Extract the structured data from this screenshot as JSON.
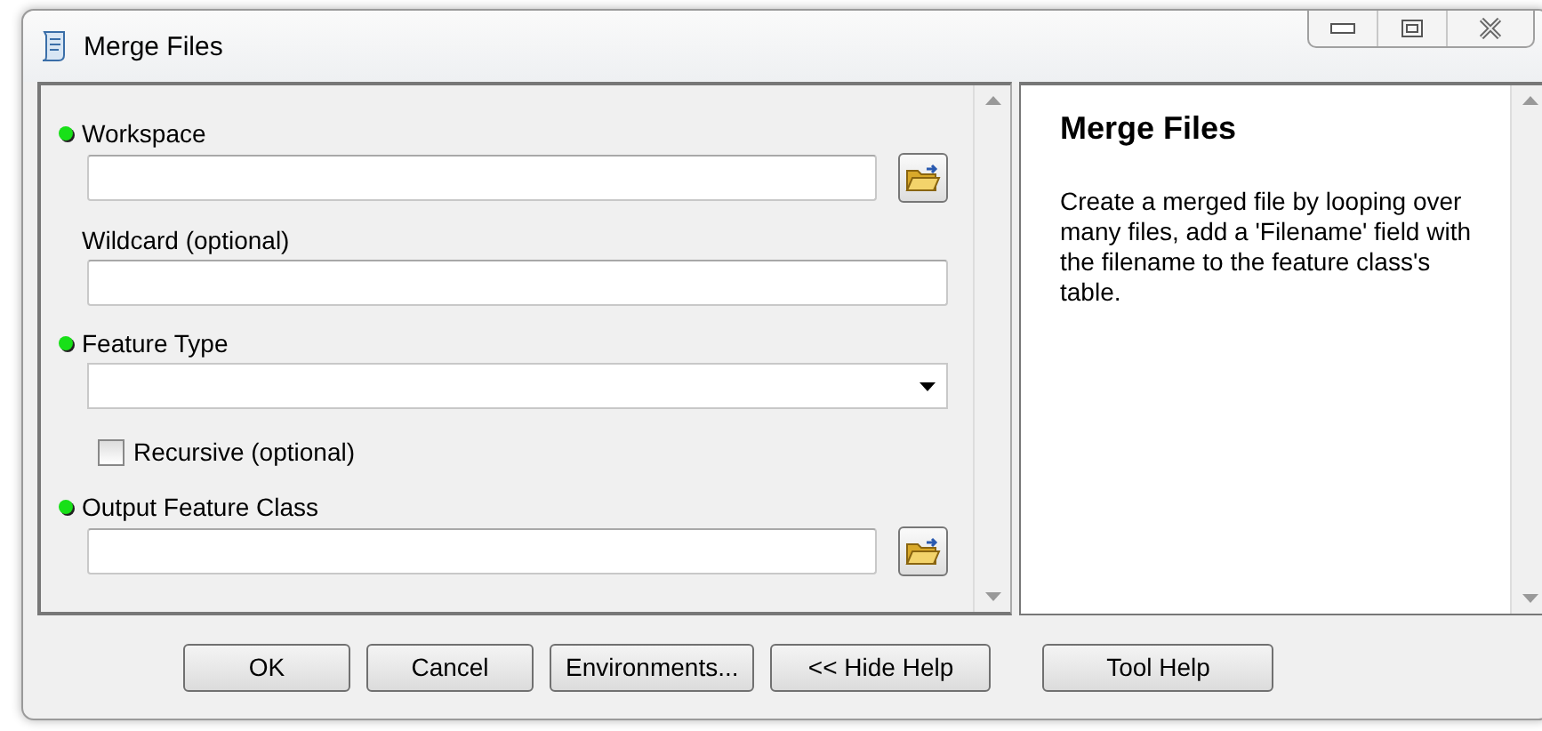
{
  "window": {
    "title": "Merge Files"
  },
  "parameters": [
    {
      "kind": "browse",
      "label": "Workspace",
      "required": true
    },
    {
      "kind": "text",
      "label": "Wildcard (optional)",
      "required": false
    },
    {
      "kind": "dropdown",
      "label": "Feature Type",
      "required": true
    },
    {
      "kind": "checkbox",
      "label": "Recursive (optional)",
      "checked": false
    },
    {
      "kind": "browse",
      "label": "Output Feature Class",
      "required": true
    }
  ],
  "help": {
    "title": "Merge Files",
    "text": "Create a merged file by looping over many files, add a 'Filename' field with the filename to the feature class's table."
  },
  "buttons": [
    {
      "label": "OK"
    },
    {
      "label": "Cancel"
    },
    {
      "label": "Environments..."
    },
    {
      "label": "<< Hide Help"
    },
    {
      "label": "Tool Help"
    }
  ]
}
